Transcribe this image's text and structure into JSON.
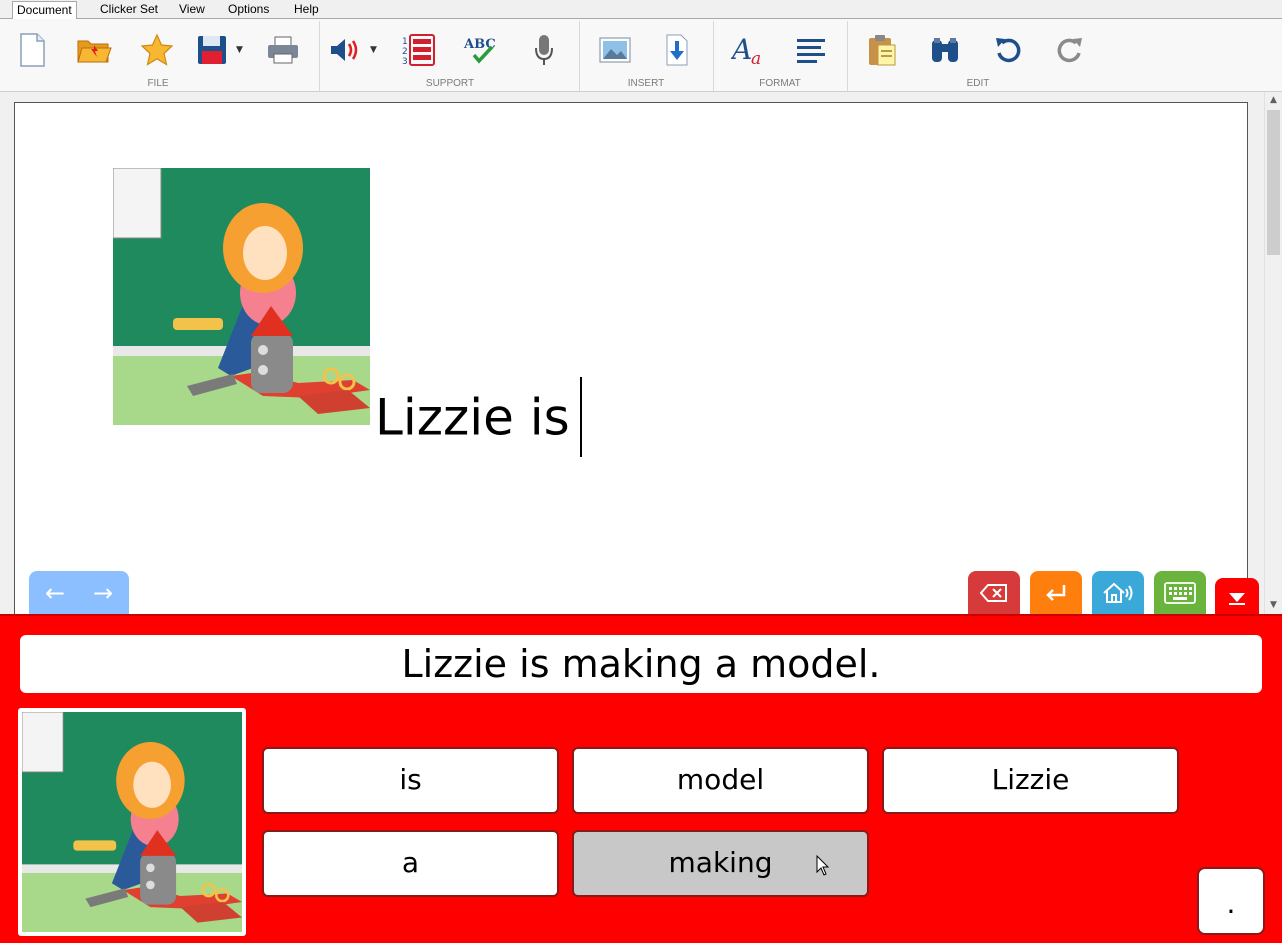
{
  "menu": {
    "tabs": [
      "Document",
      "Clicker Set",
      "View",
      "Options",
      "Help"
    ],
    "active": "Document"
  },
  "ribbon": {
    "groups": {
      "file": "FILE",
      "support": "SUPPORT",
      "insert": "INSERT",
      "format": "FORMAT",
      "edit": "EDIT"
    },
    "icons": [
      "new-document-icon",
      "open-folder-icon",
      "favourites-star-icon",
      "save-disk-icon",
      "print-icon",
      "speech-volume-icon",
      "word-list-icon",
      "spell-check-icon",
      "microphone-icon",
      "insert-picture-icon",
      "insert-file-icon",
      "font-style-icon",
      "align-left-icon",
      "paste-icon",
      "find-binoculars-icon",
      "undo-icon",
      "redo-icon"
    ]
  },
  "document": {
    "text": "Lizzie is",
    "image_alt": "Girl building a model rocket with glue and scissors"
  },
  "toolbar_buttons": {
    "backspace": "backspace-icon",
    "enter": "enter-icon",
    "speak": "speak-house-icon",
    "keyboard": "keyboard-icon",
    "collapse": "collapse-down-icon",
    "colors": {
      "backspace": "#d63a3a",
      "enter": "#ff7f0e",
      "speak": "#3aa8d8",
      "keyboard": "#6ab43e",
      "grid": "#ff0000"
    }
  },
  "grid": {
    "sentence": "Lizzie is making a model.",
    "words": [
      {
        "label": "is",
        "pressed": false
      },
      {
        "label": "model",
        "pressed": false
      },
      {
        "label": "Lizzie",
        "pressed": false
      },
      {
        "label": "a",
        "pressed": false
      },
      {
        "label": "making",
        "pressed": true
      }
    ],
    "punctuation": "."
  }
}
